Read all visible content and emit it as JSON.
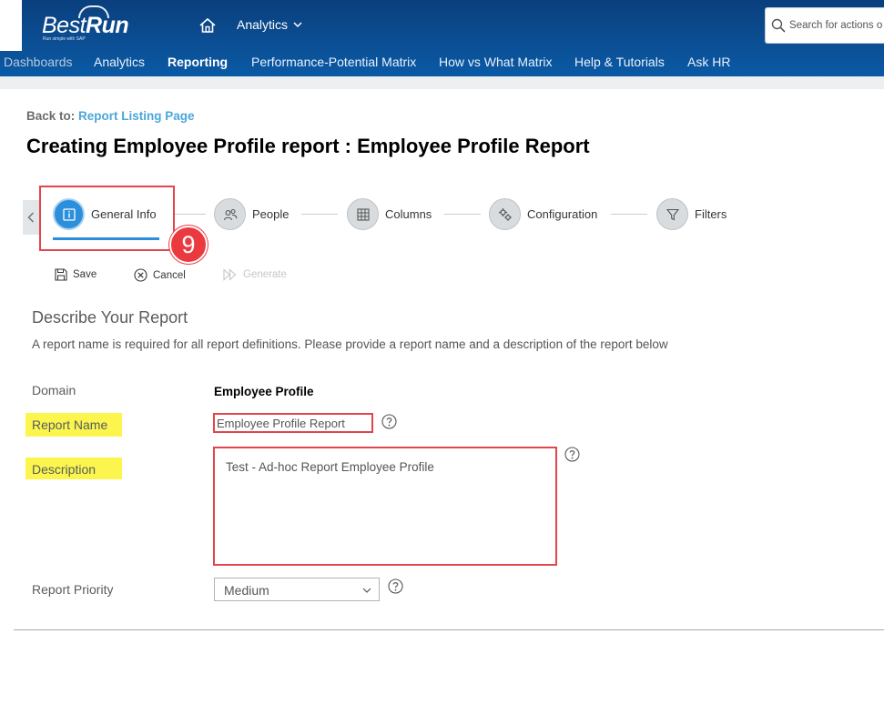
{
  "header": {
    "logo_main": "Best",
    "logo_bold": "Run",
    "logo_tagline": "Run simple with SAP",
    "menu_label": "Analytics",
    "search_placeholder": "Search for actions o"
  },
  "nav": {
    "items": [
      {
        "label": "Dashboards",
        "active": false
      },
      {
        "label": "Analytics",
        "active": false
      },
      {
        "label": "Reporting",
        "active": true
      },
      {
        "label": "Performance-Potential Matrix",
        "active": false
      },
      {
        "label": "How vs What Matrix",
        "active": false
      },
      {
        "label": "Help & Tutorials",
        "active": false
      },
      {
        "label": "Ask HR",
        "active": false
      }
    ]
  },
  "breadcrumb": {
    "prefix": "Back to:",
    "link": "Report Listing Page"
  },
  "page": {
    "title": "Creating Employee Profile report : Employee Profile Report"
  },
  "wizard": {
    "steps": [
      {
        "label": "General Info",
        "icon": "info-icon",
        "active": true
      },
      {
        "label": "People",
        "icon": "people-icon",
        "active": false
      },
      {
        "label": "Columns",
        "icon": "grid-icon",
        "active": false
      },
      {
        "label": "Configuration",
        "icon": "gears-icon",
        "active": false
      },
      {
        "label": "Filters",
        "icon": "funnel-icon",
        "active": false
      }
    ],
    "callout_number": "9"
  },
  "toolbar": {
    "save_label": "Save",
    "cancel_label": "Cancel",
    "generate_label": "Generate"
  },
  "form": {
    "section_title": "Describe Your Report",
    "section_desc": "A report name is required for all report definitions. Please provide a report name and a description of the report below",
    "domain_label": "Domain",
    "domain_value": "Employee Profile",
    "name_label": "Report Name",
    "name_value": "Employee Profile Report",
    "description_label": "Description",
    "description_value": "Test - Ad-hoc Report Employee Profile",
    "priority_label": "Report Priority",
    "priority_value": "Medium"
  },
  "colors": {
    "shell_blue": "#0b4e93",
    "accent_blue": "#2b8fdb",
    "link_blue": "#4aa6db",
    "annotation_red": "#e2454b",
    "highlight_yellow": "#fbf54d"
  }
}
